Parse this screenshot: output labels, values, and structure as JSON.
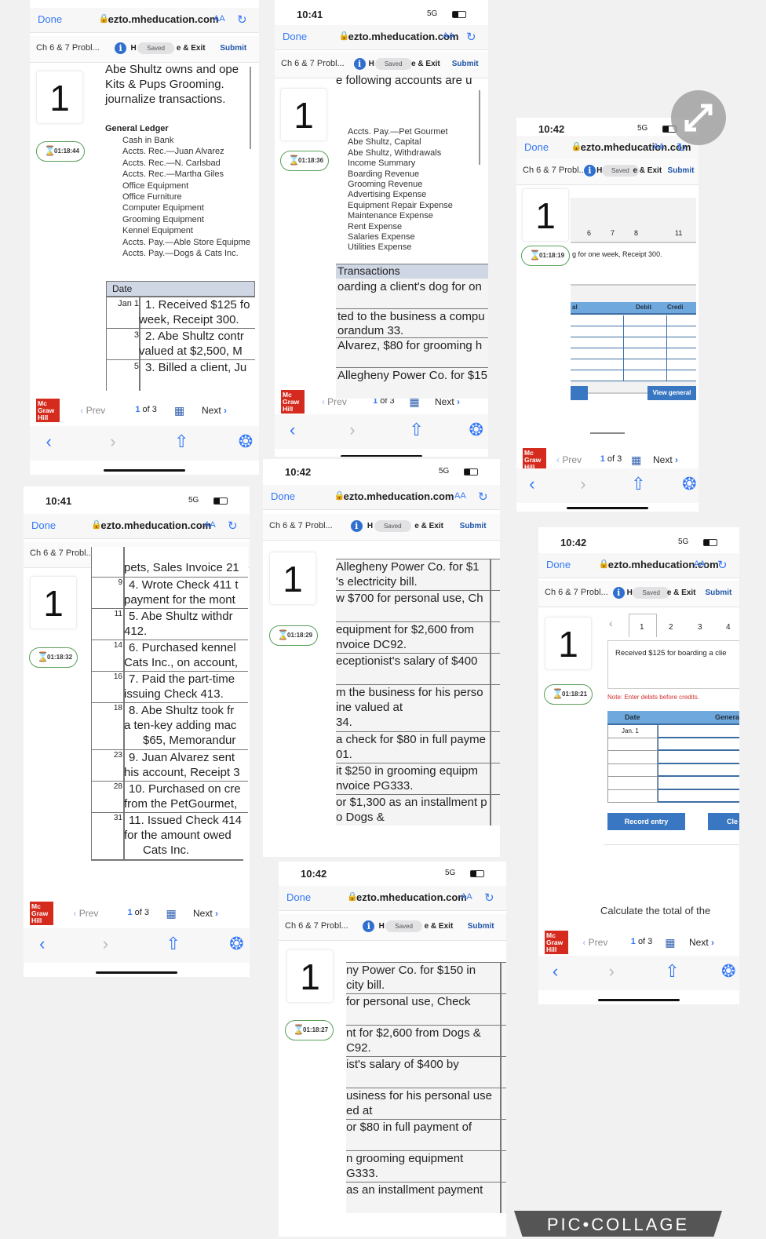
{
  "common": {
    "done": "Done",
    "url": "ezto.mheducation.com",
    "aa": "AA",
    "app_title": "Ch 6 & 7 Probl...",
    "info": "i",
    "h": "H",
    "saved": "Saved",
    "exit": "e & Exit",
    "submit": "Submit",
    "question": "1",
    "prev": "Prev",
    "page": "1",
    "of": "of 3",
    "next": "Next",
    "logo": "Mc Graw Hill",
    "signal": "5G"
  },
  "colors": {
    "link": "#3478f6",
    "brand_red": "#d52b1e",
    "table_header": "#6fa8dc",
    "button": "#3a77c2",
    "timer_border": "#5aa05a",
    "note": "#d32f2f"
  },
  "panels": [
    {
      "timer": "01:18:44",
      "prompt": [
        "Abe Shultz owns and ope",
        "Kits & Pups Grooming.",
        "journalize transactions."
      ],
      "ledger_title": "General Ledger",
      "accounts": [
        "Cash in Bank",
        "Accts. Rec.—Juan Alvarez",
        "Accts. Rec.—N. Carlsbad",
        "Accts. Rec.—Martha Giles",
        "Office Equipment",
        "Office Furniture",
        "Computer Equipment",
        "Grooming Equipment",
        "Kennel Equipment",
        "Accts. Pay.—Able Store Equipme",
        "Accts. Pay.—Dogs & Cats Inc."
      ],
      "table_header": "Date",
      "rows": [
        {
          "date": "Jan 1",
          "lines": [
            "1. Received $125 fo",
            "week, Receipt 300."
          ]
        },
        {
          "date": "3",
          "lines": [
            "2. Abe Shultz contr",
            "valued at $2,500, M"
          ]
        },
        {
          "date": "5",
          "lines": [
            "3. Billed a client, Ju"
          ]
        }
      ]
    },
    {
      "time": "10:41",
      "timer": "01:18:36",
      "prompt": [
        "e following accounts are u"
      ],
      "accounts": [
        "Accts. Pay.—Pet Gourmet",
        "Abe Shultz, Capital",
        "Abe Shultz, Withdrawals",
        "Income Summary",
        "Boarding Revenue",
        "Grooming Revenue",
        "Advertising Expense",
        "Equipment Repair Expense",
        "Maintenance Expense",
        "Rent Expense",
        "Salaries Expense",
        "Utilities Expense"
      ],
      "table_header": "Transactions",
      "rows": [
        {
          "lines": [
            "oarding a client's dog for on"
          ]
        },
        {
          "lines": [
            "ted to the business a compu",
            "orandum 33."
          ]
        },
        {
          "lines": [
            "Alvarez, $80 for grooming h"
          ]
        },
        {
          "lines": [
            "Allegheny Power Co. for $15"
          ]
        }
      ]
    },
    {
      "time": "10:42",
      "timer": "01:18:19",
      "tabs": [
        "6",
        "7",
        "8",
        "11"
      ],
      "text": "g for one week, Receipt 300.",
      "cols": [
        "al",
        "Debit",
        "Credi"
      ],
      "view": "View general"
    },
    {
      "time": "10:41",
      "timer": "01:18:32",
      "rows": [
        {
          "date": "",
          "lines": [
            "pets, Sales Invoice 21"
          ]
        },
        {
          "date": "9",
          "lines": [
            "4. Wrote Check 411 t",
            "payment for the mont"
          ]
        },
        {
          "date": "11",
          "lines": [
            "5. Abe Shultz withdr",
            "412."
          ]
        },
        {
          "date": "14",
          "lines": [
            "6. Purchased kennel",
            "Cats Inc., on account,"
          ]
        },
        {
          "date": "16",
          "lines": [
            "7. Paid the part-time",
            "issuing Check 413."
          ]
        },
        {
          "date": "18",
          "lines": [
            "8. Abe Shultz took fr",
            "a ten-key adding mac",
            "$65, Memorandur"
          ]
        },
        {
          "date": "23",
          "lines": [
            "9. Juan Alvarez sent",
            "his account, Receipt 3"
          ]
        },
        {
          "date": "28",
          "lines": [
            "10. Purchased on cre",
            "from the PetGourmet,"
          ]
        },
        {
          "date": "31",
          "lines": [
            "11. Issued Check 414",
            "for the amount owed",
            "Cats Inc."
          ]
        }
      ]
    },
    {
      "time": "10:42",
      "timer": "01:18:29",
      "rows": [
        {
          "lines": [
            "Allegheny Power Co. for $1",
            "'s electricity bill."
          ]
        },
        {
          "lines": [
            "w $700 for personal use, Ch"
          ]
        },
        {
          "lines": [
            "equipment for $2,600 from",
            "nvoice DC92."
          ]
        },
        {
          "lines": [
            "eceptionist's salary of $400"
          ]
        },
        {
          "lines": [
            "m the business for his perso",
            "ine valued at",
            "34."
          ]
        },
        {
          "lines": [
            "a check for $80 in full payme",
            "01."
          ]
        },
        {
          "lines": [
            "it $250 in grooming equipm",
            "nvoice PG333."
          ]
        },
        {
          "lines": [
            "or $1,300 as an installment p",
            "o Dogs &"
          ]
        }
      ]
    },
    {
      "time": "10:42",
      "timer": "01:18:21",
      "tabs": [
        "1",
        "2",
        "3",
        "4"
      ],
      "text": "Received $125 for boarding a clie",
      "note": "Note: Enter debits before credits.",
      "cols": [
        "Date",
        "Genera"
      ],
      "first_date": "Jan. 1",
      "record": "Record entry",
      "clear": "Cle"
    },
    {
      "time": "10:42",
      "timer": "01:18:27",
      "rows": [
        {
          "lines": [
            "ny Power Co. for $150 in",
            "city bill."
          ]
        },
        {
          "lines": [
            "for personal use, Check"
          ]
        },
        {
          "lines": [
            "nt for $2,600 from Dogs &",
            "C92."
          ]
        },
        {
          "lines": [
            "ist's salary of $400 by"
          ]
        },
        {
          "lines": [
            "usiness for his personal use",
            "ed at"
          ]
        },
        {
          "lines": [
            "or $80 in full payment of"
          ]
        },
        {
          "lines": [
            "n grooming equipment",
            "G333."
          ]
        },
        {
          "lines": [
            "as an installment payment"
          ]
        }
      ]
    }
  ],
  "stray_text": "Calculate the total of the",
  "watermark": "PIC•COLLAGE"
}
